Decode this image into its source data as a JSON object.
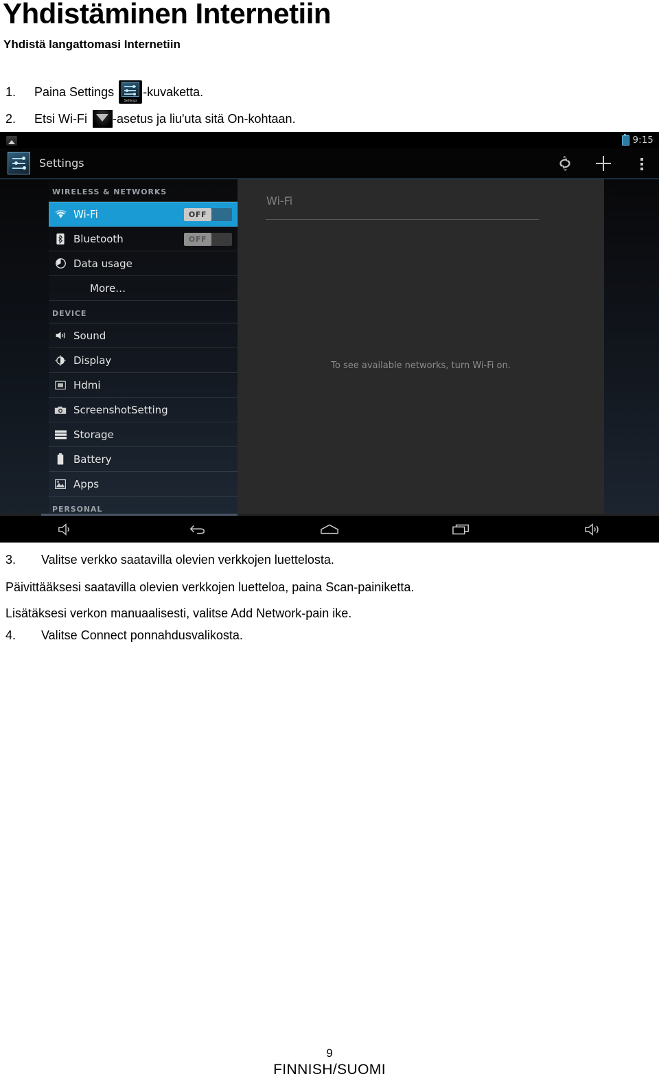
{
  "document": {
    "title": "Yhdistäminen Internetiin",
    "subtitle": "Yhdistä langattomasi Internetiin",
    "steps_top": [
      {
        "number": "1.",
        "text_before": "Paina Settings",
        "icon": "settings-app-icon",
        "text_after": "-kuvaketta."
      },
      {
        "number": "2.",
        "text_before": "Etsi Wi-Fi",
        "icon": "wifi-tile-icon",
        "text_after": "-asetus ja liu'uta sitä On-kohtaan."
      }
    ],
    "steps_bottom": [
      {
        "number": "3.",
        "text": "Valitse verkko saatavilla olevien verkkojen luettelosta."
      },
      {
        "number": "4.",
        "text": "Valitse Connect ponnahdusvalikosta."
      }
    ],
    "paragraphs": [
      "Päivittääksesi saatavilla olevien verkkojen luetteloa, paina Scan-painiketta.",
      "Lisätäksesi verkon manuaalisesti, valitse Add Network-pain ike."
    ],
    "footer": {
      "page_number": "9",
      "language": "FINNISH/SUOMI"
    }
  },
  "screenshot": {
    "status_bar": {
      "notification_icon": "screenshot-capture-icon",
      "battery_icon": "battery-icon",
      "clock": "9:15"
    },
    "action_bar": {
      "app_icon": "settings-icon",
      "title": "Settings",
      "actions": [
        {
          "name": "refresh-icon",
          "label": "Refresh"
        },
        {
          "name": "add-network-icon",
          "label": "Add network"
        },
        {
          "name": "overflow-menu-icon",
          "label": "More options"
        }
      ]
    },
    "settings_list": [
      {
        "type": "header",
        "label": "WIRELESS & NETWORKS"
      },
      {
        "type": "item",
        "icon": "wifi-icon",
        "label": "Wi-Fi",
        "toggle": "OFF",
        "selected": true
      },
      {
        "type": "item",
        "icon": "bluetooth-icon",
        "label": "Bluetooth",
        "toggle": "OFF",
        "selected": false
      },
      {
        "type": "item",
        "icon": "data-usage-icon",
        "label": "Data usage",
        "selected": false
      },
      {
        "type": "item",
        "icon": "none",
        "label": "More…",
        "selected": false
      },
      {
        "type": "header",
        "label": "DEVICE"
      },
      {
        "type": "item",
        "icon": "sound-icon",
        "label": "Sound",
        "selected": false
      },
      {
        "type": "item",
        "icon": "display-icon",
        "label": "Display",
        "selected": false
      },
      {
        "type": "item",
        "icon": "hdmi-icon",
        "label": "Hdmi",
        "selected": false
      },
      {
        "type": "item",
        "icon": "screenshot-icon",
        "label": "ScreenshotSetting",
        "selected": false
      },
      {
        "type": "item",
        "icon": "storage-icon",
        "label": "Storage",
        "selected": false
      },
      {
        "type": "item",
        "icon": "battery-icon",
        "label": "Battery",
        "selected": false
      },
      {
        "type": "item",
        "icon": "apps-icon",
        "label": "Apps",
        "selected": false
      },
      {
        "type": "header",
        "label": "PERSONAL"
      }
    ],
    "detail_pane": {
      "title": "Wi-Fi",
      "empty_message": "To see available networks, turn Wi-Fi on."
    },
    "nav_bar": [
      {
        "name": "volume-down-icon",
        "label": "Volume down"
      },
      {
        "name": "back-icon",
        "label": "Back"
      },
      {
        "name": "home-icon",
        "label": "Home"
      },
      {
        "name": "recents-icon",
        "label": "Recent apps"
      },
      {
        "name": "volume-up-icon",
        "label": "Volume up"
      }
    ],
    "colors": {
      "accent_selected": "#1b9bd4",
      "action_bar_underline": "#2f6d8c",
      "detail_pane_bg": "#2a2a2a",
      "status_battery": "#5fb0d6"
    }
  }
}
